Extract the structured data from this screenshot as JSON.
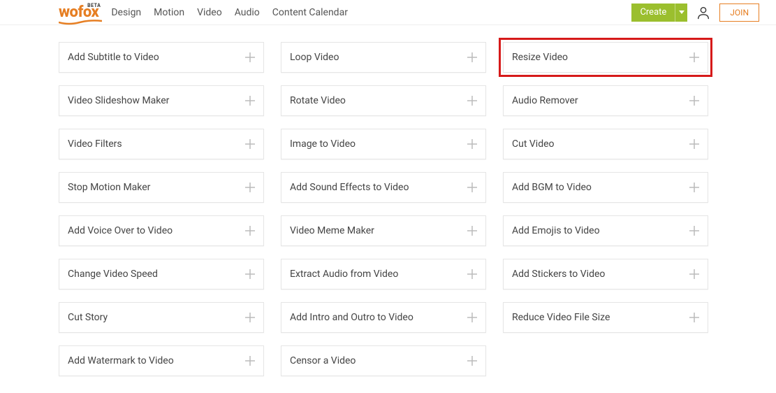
{
  "header": {
    "logo_text": "wofox",
    "logo_beta": "BETA",
    "nav_items": [
      "Design",
      "Motion",
      "Video",
      "Audio",
      "Content Calendar"
    ],
    "create_label": "Create",
    "join_label": "JOIN"
  },
  "highlight_index": 2,
  "tools": [
    "Add Subtitle to Video",
    "Loop Video",
    "Resize Video",
    "Video Slideshow Maker",
    "Rotate Video",
    "Audio Remover",
    "Video Filters",
    "Image to Video",
    "Cut Video",
    "Stop Motion Maker",
    "Add Sound Effects to Video",
    "Add BGM to Video",
    "Add Voice Over to Video",
    "Video Meme Maker",
    "Add Emojis to Video",
    "Change Video Speed",
    "Extract Audio from Video",
    "Add Stickers to Video",
    "Cut Story",
    "Add Intro and Outro to Video",
    "Reduce Video File Size",
    "Add Watermark to Video",
    "Censor a Video"
  ]
}
